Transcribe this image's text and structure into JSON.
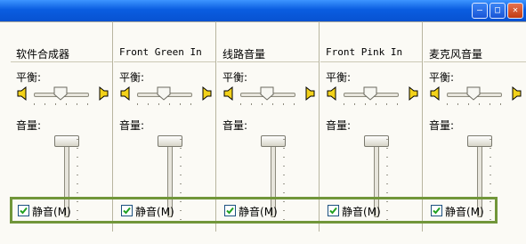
{
  "window": {
    "min_glyph": "–",
    "max_glyph": "□",
    "close_glyph": "✕"
  },
  "labels": {
    "balance": "平衡:",
    "volume": "音量:"
  },
  "channels": [
    {
      "title": "软件合成器",
      "balance": 0.5,
      "volume": 1.0,
      "muted": true,
      "mute_label": "静音",
      "mute_hotkey": "(M)"
    },
    {
      "title": "Front Green In",
      "balance": 0.5,
      "volume": 1.0,
      "muted": true,
      "mute_label": "静音",
      "mute_hotkey": "(M)"
    },
    {
      "title": "线路音量",
      "balance": 0.5,
      "volume": 1.0,
      "muted": true,
      "mute_label": "静音",
      "mute_hotkey": "(M)"
    },
    {
      "title": "Front Pink In",
      "balance": 0.5,
      "volume": 1.0,
      "muted": true,
      "mute_label": "静音",
      "mute_hotkey": "(M)"
    },
    {
      "title": "麦克风音量",
      "balance": 0.5,
      "volume": 1.0,
      "muted": true,
      "mute_label": "静音",
      "mute_hotkey": "(M)"
    }
  ],
  "colors": {
    "title_bar": "#0a5de0",
    "highlight": "#71963a",
    "background": "#fbfaf5"
  }
}
